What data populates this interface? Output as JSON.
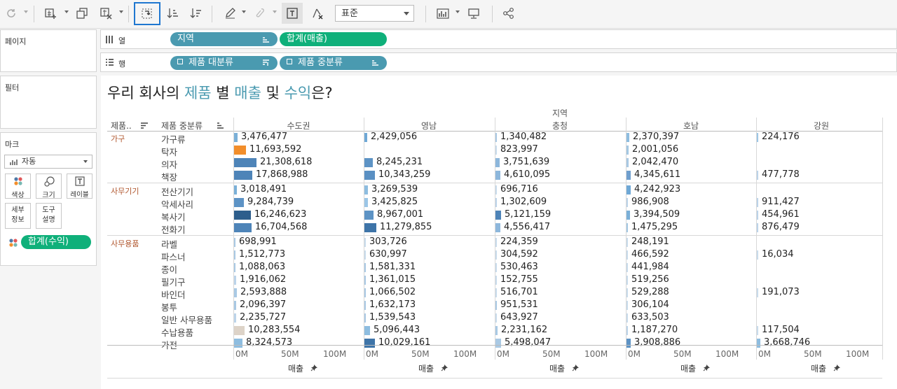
{
  "toolbar": {
    "fit_value": "표준",
    "icons": [
      "refresh-icon",
      "new-worksheet-icon",
      "duplicate-sheet-icon",
      "clear-sheet-icon",
      "swap-rows-columns-icon",
      "sort-ascending-icon",
      "sort-descending-icon",
      "highlight-icon",
      "group-icon",
      "show-labels-icon",
      "fix-axes-icon",
      "show-me-icon",
      "presentation-icon",
      "share-icon"
    ]
  },
  "panels": {
    "pages": "페이지",
    "filters": "필터",
    "marks": "마크"
  },
  "marks": {
    "type_value": "자동",
    "cards": {
      "color": "색상",
      "size": "크기",
      "label": "레이블",
      "detail": "세부\n정보",
      "tooltip": "도구\n설명"
    },
    "pill": "합계(수익)"
  },
  "shelves": {
    "columns_label": "열",
    "rows_label": "행",
    "columns_pills": [
      "지역",
      "합계(매출)"
    ],
    "rows_pills": [
      "제품 대분류",
      "제품 중분류"
    ]
  },
  "view": {
    "title_parts": [
      {
        "t": "우리 회사의 ",
        "c": "#222"
      },
      {
        "t": "제품",
        "c": "#4a9ab0"
      },
      {
        "t": " 별 ",
        "c": "#222"
      },
      {
        "t": "매출",
        "c": "#4a9ab0"
      },
      {
        "t": " 및 ",
        "c": "#222"
      },
      {
        "t": "수익",
        "c": "#4a9ab0"
      },
      {
        "t": "은?",
        "c": "#222"
      }
    ],
    "region_header": "지역",
    "col_header_1": "제품..",
    "col_header_2": "제품 중분류",
    "axis_title": "매출",
    "axis_ticks": [
      "0M",
      "50M",
      "100M"
    ]
  },
  "chart_data": {
    "type": "bar",
    "title": "우리 회사의 제품 별 매출 및 수익은?",
    "regions": [
      "수도권",
      "영남",
      "충청",
      "호남",
      "강원"
    ],
    "xlabel": "매출",
    "xlim": [
      0,
      100000000
    ],
    "groups": [
      {
        "name": "가구",
        "rows": [
          {
            "label": "가구류",
            "values": [
              3476477,
              2429056,
              1340482,
              2370397,
              224176
            ],
            "labels": [
              "3,476,477",
              "2,429,056",
              "1,340,482",
              "2,370,397",
              "224,176"
            ]
          },
          {
            "label": "탁자",
            "values": [
              11693592,
              0,
              823997,
              2001056,
              null
            ],
            "labels": [
              "11,693,592",
              "",
              "823,997",
              "2,001,056",
              ""
            ]
          },
          {
            "label": "의자",
            "values": [
              21308618,
              8245231,
              3751639,
              2042470,
              null
            ],
            "labels": [
              "21,308,618",
              "8,245,231",
              "3,751,639",
              "2,042,470",
              ""
            ]
          },
          {
            "label": "책장",
            "values": [
              17868988,
              10343259,
              4610095,
              4345611,
              477778
            ],
            "labels": [
              "17,868,988",
              "10,343,259",
              "4,610,095",
              "4,345,611",
              "477,778"
            ]
          }
        ]
      },
      {
        "name": "사무기기",
        "rows": [
          {
            "label": "전산기기",
            "values": [
              3018491,
              3269539,
              696716,
              4242923,
              null
            ],
            "labels": [
              "3,018,491",
              "3,269,539",
              "696,716",
              "4,242,923",
              ""
            ]
          },
          {
            "label": "악세사리",
            "values": [
              9284739,
              3425825,
              1302609,
              986908,
              911427
            ],
            "labels": [
              "9,284,739",
              "3,425,825",
              "1,302,609",
              "986,908",
              "911,427"
            ]
          },
          {
            "label": "복사기",
            "values": [
              16246623,
              8967001,
              5121159,
              3394509,
              454961
            ],
            "labels": [
              "16,246,623",
              "8,967,001",
              "5,121,159",
              "3,394,509",
              "454,961"
            ]
          },
          {
            "label": "전화기",
            "values": [
              16704568,
              11279855,
              4556417,
              1475295,
              876479
            ],
            "labels": [
              "16,704,568",
              "11,279,855",
              "4,556,417",
              "1,475,295",
              "876,479"
            ]
          }
        ]
      },
      {
        "name": "사무용품",
        "rows": [
          {
            "label": "라벨",
            "values": [
              698991,
              303726,
              224359,
              248191,
              null
            ],
            "labels": [
              "698,991",
              "303,726",
              "224,359",
              "248,191",
              ""
            ]
          },
          {
            "label": "파스너",
            "values": [
              1512773,
              630997,
              304592,
              466592,
              16034
            ],
            "labels": [
              "1,512,773",
              "630,997",
              "304,592",
              "466,592",
              "16,034"
            ]
          },
          {
            "label": "종이",
            "values": [
              1088063,
              1581331,
              530463,
              441984,
              null
            ],
            "labels": [
              "1,088,063",
              "1,581,331",
              "530,463",
              "441,984",
              ""
            ]
          },
          {
            "label": "필기구",
            "values": [
              1916062,
              1361015,
              152755,
              519256,
              null
            ],
            "labels": [
              "1,916,062",
              "1,361,015",
              "152,755",
              "519,256",
              ""
            ]
          },
          {
            "label": "바인더",
            "values": [
              2593888,
              1066502,
              516701,
              529288,
              191073
            ],
            "labels": [
              "2,593,888",
              "1,066,502",
              "516,701",
              "529,288",
              "191,073"
            ]
          },
          {
            "label": "봉투",
            "values": [
              2096397,
              1632173,
              951531,
              306104,
              null
            ],
            "labels": [
              "2,096,397",
              "1,632,173",
              "951,531",
              "306,104",
              ""
            ]
          },
          {
            "label": "일반 사무용품",
            "values": [
              2235727,
              1539543,
              643927,
              633503,
              null
            ],
            "labels": [
              "2,235,727",
              "1,539,543",
              "643,927",
              "633,503",
              ""
            ]
          },
          {
            "label": "수납용품",
            "values": [
              10283554,
              5096443,
              2231162,
              1187270,
              117504
            ],
            "labels": [
              "10,283,554",
              "5,096,443",
              "2,231,162",
              "1,187,270",
              "117,504"
            ]
          },
          {
            "label": "가전",
            "values": [
              8324573,
              10029161,
              5498047,
              3908886,
              3668746
            ],
            "labels": [
              "8,324,573",
              "10,029,161",
              "5,498,047",
              "3,908,886",
              "3,668,746"
            ]
          }
        ]
      }
    ],
    "bar_colors": [
      [
        "#7bb0d8",
        "#6fa8d6",
        "#a9c9e4",
        "#8ebde0",
        "#9cc6e6"
      ],
      [
        "#f28e2b",
        "#c9dcec",
        "#c9dcec",
        "#a4c8e3",
        ""
      ],
      [
        "#4e84b8",
        "#5d93c5",
        "#8db7dc",
        "#a9c9e4",
        ""
      ],
      [
        "#4e84b8",
        "#5a90c3",
        "#8db7dc",
        "#6f9fce",
        "#bcd4ea"
      ],
      [
        "#7bb0d8",
        "#8ebde0",
        "#c9dcec",
        "#6fa8d6",
        ""
      ],
      [
        "#5d93c5",
        "#9cc6e6",
        "#bcd4ea",
        "#bcd4ea",
        "#bcd4ea"
      ],
      [
        "#2d5e8c",
        "#5d93c5",
        "#4e84b8",
        "#7bb0d8",
        "#bcd4ea"
      ],
      [
        "#4e84b8",
        "#3e74a8",
        "#8db7dc",
        "#a4c8e3",
        "#bcd4ea"
      ],
      [
        "#a9c9e4",
        "#c9dcec",
        "#c9dcec",
        "#c9dcec",
        ""
      ],
      [
        "#a9c9e4",
        "#c9dcec",
        "#c9dcec",
        "#c9dcec",
        "#c9dcec"
      ],
      [
        "#a9c9e4",
        "#a9c9e4",
        "#c9dcec",
        "#c9dcec",
        ""
      ],
      [
        "#bcd4ea",
        "#a9c9e4",
        "#c9dcec",
        "#c9dcec",
        ""
      ],
      [
        "#a9c9e4",
        "#a9c9e4",
        "#c9dcec",
        "#c9dcec",
        "#c9dcec"
      ],
      [
        "#a9c9e4",
        "#a9c9e4",
        "#a9c9e4",
        "#c9dcec",
        ""
      ],
      [
        "#bcd4ea",
        "#a9c9e4",
        "#c9dcec",
        "#c9dcec",
        ""
      ],
      [
        "#ddd3c8",
        "#8ebde0",
        "#a9c9e4",
        "#bcd4ea",
        "#c9dcec"
      ],
      [
        "#8ebde0",
        "#3e74a8",
        "#a9c9e4",
        "#5d93c5",
        "#8ebde0"
      ]
    ]
  }
}
